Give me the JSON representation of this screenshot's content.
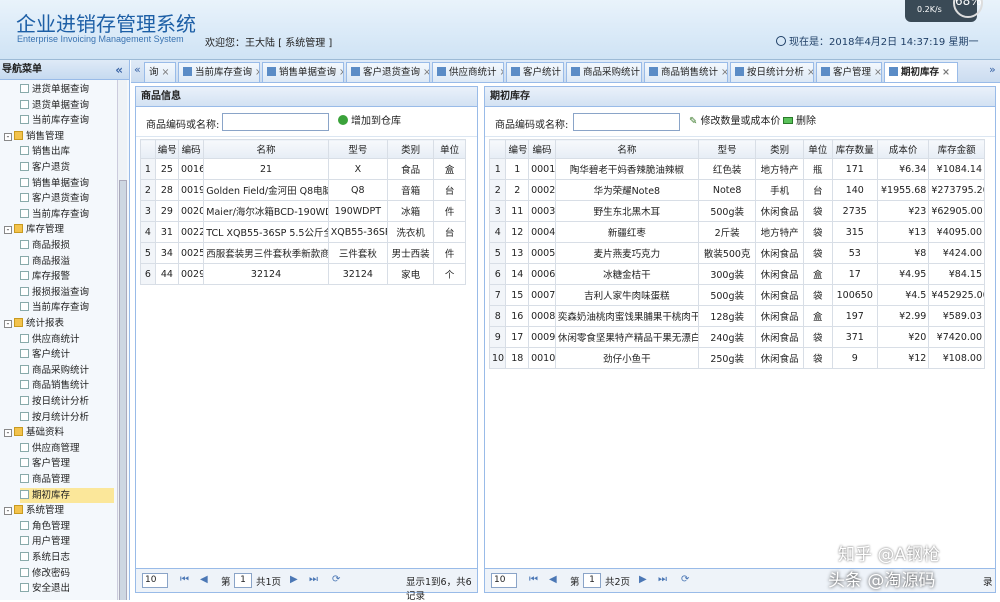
{
  "header": {
    "title_cn": "企业进销存管理系统",
    "title_en": "Enterprise Invoicing Management System",
    "welcome": "欢迎您：王大陆  [ 系统管理 ]",
    "datetime": "现在是：2018年4月2日 14:37:19 星期一",
    "net_speed": "0.2K/s",
    "net_pct": "68%"
  },
  "nav": {
    "title": "导航菜单",
    "collapse": "«",
    "items": [
      {
        "label": "进货单据查询",
        "level": 2,
        "icon": "doc-icon"
      },
      {
        "label": "退货单据查询",
        "level": 2,
        "icon": "doc-icon"
      },
      {
        "label": "当前库存查询",
        "level": 2,
        "icon": "doc-icon"
      },
      {
        "label": "销售管理",
        "level": 1,
        "icon": "folder-icon",
        "toggle": "-"
      },
      {
        "label": "销售出库",
        "level": 2,
        "icon": "doc-icon"
      },
      {
        "label": "客户退货",
        "level": 2,
        "icon": "doc-icon"
      },
      {
        "label": "销售单据查询",
        "level": 2,
        "icon": "doc-icon"
      },
      {
        "label": "客户退货查询",
        "level": 2,
        "icon": "doc-icon"
      },
      {
        "label": "当前库存查询",
        "level": 2,
        "icon": "doc-icon"
      },
      {
        "label": "库存管理",
        "level": 1,
        "icon": "folder-icon",
        "toggle": "-"
      },
      {
        "label": "商品报损",
        "level": 2,
        "icon": "doc-icon"
      },
      {
        "label": "商品报溢",
        "level": 2,
        "icon": "doc-icon"
      },
      {
        "label": "库存报警",
        "level": 2,
        "icon": "doc-icon"
      },
      {
        "label": "报损报溢查询",
        "level": 2,
        "icon": "doc-icon"
      },
      {
        "label": "当前库存查询",
        "level": 2,
        "icon": "doc-icon"
      },
      {
        "label": "统计报表",
        "level": 1,
        "icon": "folder-icon",
        "toggle": "-"
      },
      {
        "label": "供应商统计",
        "level": 2,
        "icon": "doc-icon"
      },
      {
        "label": "客户统计",
        "level": 2,
        "icon": "doc-icon"
      },
      {
        "label": "商品采购统计",
        "level": 2,
        "icon": "doc-icon"
      },
      {
        "label": "商品销售统计",
        "level": 2,
        "icon": "doc-icon"
      },
      {
        "label": "按日统计分析",
        "level": 2,
        "icon": "doc-icon"
      },
      {
        "label": "按月统计分析",
        "level": 2,
        "icon": "doc-icon"
      },
      {
        "label": "基础资料",
        "level": 1,
        "icon": "folder-icon",
        "toggle": "-"
      },
      {
        "label": "供应商管理",
        "level": 2,
        "icon": "doc-icon"
      },
      {
        "label": "客户管理",
        "level": 2,
        "icon": "doc-icon"
      },
      {
        "label": "商品管理",
        "level": 2,
        "icon": "doc-icon"
      },
      {
        "label": "期初库存",
        "level": 2,
        "icon": "doc-icon",
        "selected": true
      },
      {
        "label": "系统管理",
        "level": 1,
        "icon": "folder-icon",
        "toggle": "-"
      },
      {
        "label": "角色管理",
        "level": 2,
        "icon": "doc-icon"
      },
      {
        "label": "用户管理",
        "level": 2,
        "icon": "doc-icon"
      },
      {
        "label": "系统日志",
        "level": 2,
        "icon": "doc-icon"
      },
      {
        "label": "修改密码",
        "level": 2,
        "icon": "doc-icon"
      },
      {
        "label": "安全退出",
        "level": 2,
        "icon": "doc-icon"
      }
    ]
  },
  "tabs": [
    {
      "label": "询",
      "active": false
    },
    {
      "label": "当前库存查询",
      "active": false
    },
    {
      "label": "销售单据查询",
      "active": false
    },
    {
      "label": "客户退货查询",
      "active": false
    },
    {
      "label": "供应商统计",
      "active": false
    },
    {
      "label": "客户统计",
      "active": false
    },
    {
      "label": "商品采购统计",
      "active": false
    },
    {
      "label": "商品销售统计",
      "active": false
    },
    {
      "label": "按日统计分析",
      "active": false
    },
    {
      "label": "客户管理",
      "active": false
    },
    {
      "label": "期初库存",
      "active": true
    }
  ],
  "left_panel": {
    "title": "商品信息",
    "search_label": "商品编码或名称:",
    "search_value": "",
    "add_button": "增加到仓库",
    "columns": [
      "编号",
      "编码",
      "名称",
      "型号",
      "类别",
      "单位"
    ],
    "rows": [
      {
        "n": "1",
        "id": "25",
        "code": "0016",
        "name": "21",
        "model": "X",
        "cat": "食品",
        "unit": "盒"
      },
      {
        "n": "2",
        "id": "28",
        "code": "0019",
        "name": "Golden Field/金河田 Q8电脑音箱",
        "model": "Q8",
        "cat": "音箱",
        "unit": "台"
      },
      {
        "n": "3",
        "id": "29",
        "code": "0020",
        "name": "Maier/海尔冰箱BCD-190WDPT双门",
        "model": "190WDPT",
        "cat": "冰箱",
        "unit": "件"
      },
      {
        "n": "4",
        "id": "31",
        "code": "0022",
        "name": "TCL XQB55-36SP 5.5公斤全自动波",
        "model": "XQB55-36SP",
        "cat": "洗衣机",
        "unit": "台"
      },
      {
        "n": "5",
        "id": "34",
        "code": "0025",
        "name": "西服套装男三件套秋季新款商务休闲",
        "model": "三件套秋",
        "cat": "男士西装",
        "unit": "件"
      },
      {
        "n": "6",
        "id": "44",
        "code": "0029",
        "name": "32124",
        "model": "32124",
        "cat": "家电",
        "unit": "个"
      }
    ],
    "pager": {
      "page_size": "10",
      "page_label": "第",
      "page": "1",
      "total_pages": "共1页",
      "summary": "显示1到6，共6记录"
    }
  },
  "right_panel": {
    "title": "期初库存",
    "search_label": "商品编码或名称:",
    "search_value": "",
    "edit_button": "修改数量或成本价",
    "delete_button": "删除",
    "columns": [
      "编号",
      "编码",
      "名称",
      "型号",
      "类别",
      "单位",
      "库存数量",
      "成本价",
      "库存金额"
    ],
    "rows": [
      {
        "n": "1",
        "id": "1",
        "code": "0001",
        "name": "陶华碧老干妈香辣脆油辣椒",
        "model": "红色装",
        "cat": "地方特产",
        "unit": "瓶",
        "qty": "171",
        "cost": "¥6.34",
        "amount": "¥1084.14"
      },
      {
        "n": "2",
        "id": "2",
        "code": "0002",
        "name": "华为荣耀Note8",
        "model": "Note8",
        "cat": "手机",
        "unit": "台",
        "qty": "140",
        "cost": "¥1955.68",
        "amount": "¥273795.20"
      },
      {
        "n": "3",
        "id": "11",
        "code": "0003",
        "name": "野生东北黑木耳",
        "model": "500g装",
        "cat": "休闲食品",
        "unit": "袋",
        "qty": "2735",
        "cost": "¥23",
        "amount": "¥62905.00"
      },
      {
        "n": "4",
        "id": "12",
        "code": "0004",
        "name": "新疆红枣",
        "model": "2斤装",
        "cat": "地方特产",
        "unit": "袋",
        "qty": "315",
        "cost": "¥13",
        "amount": "¥4095.00"
      },
      {
        "n": "5",
        "id": "13",
        "code": "0005",
        "name": "麦片燕麦巧克力",
        "model": "散装500克",
        "cat": "休闲食品",
        "unit": "袋",
        "qty": "53",
        "cost": "¥8",
        "amount": "¥424.00"
      },
      {
        "n": "6",
        "id": "14",
        "code": "0006",
        "name": "冰糖金桔干",
        "model": "300g装",
        "cat": "休闲食品",
        "unit": "盒",
        "qty": "17",
        "cost": "¥4.95",
        "amount": "¥84.15"
      },
      {
        "n": "7",
        "id": "15",
        "code": "0007",
        "name": "吉利人家牛肉味蛋糕",
        "model": "500g装",
        "cat": "休闲食品",
        "unit": "袋",
        "qty": "100650",
        "cost": "¥4.5",
        "amount": "¥452925.00"
      },
      {
        "n": "8",
        "id": "16",
        "code": "0008",
        "name": "奕森奶油桃肉蜜饯果脯果干桃肉干休",
        "model": "128g装",
        "cat": "休闲食品",
        "unit": "盒",
        "qty": "197",
        "cost": "¥2.99",
        "amount": "¥589.03"
      },
      {
        "n": "9",
        "id": "17",
        "code": "0009",
        "name": "休闲零食坚果特产精品干果无漂白大",
        "model": "240g装",
        "cat": "休闲食品",
        "unit": "袋",
        "qty": "371",
        "cost": "¥20",
        "amount": "¥7420.00"
      },
      {
        "n": "10",
        "id": "18",
        "code": "0010",
        "name": "劲仔小鱼干",
        "model": "250g装",
        "cat": "休闲食品",
        "unit": "袋",
        "qty": "9",
        "cost": "¥12",
        "amount": "¥108.00"
      }
    ],
    "pager": {
      "page_size": "10",
      "page_label": "第",
      "page": "1",
      "total_pages": "共2页",
      "summary": "录"
    }
  },
  "watermark": {
    "line1": "知乎 @A钢枪",
    "line2": "头条 @淘源码"
  }
}
